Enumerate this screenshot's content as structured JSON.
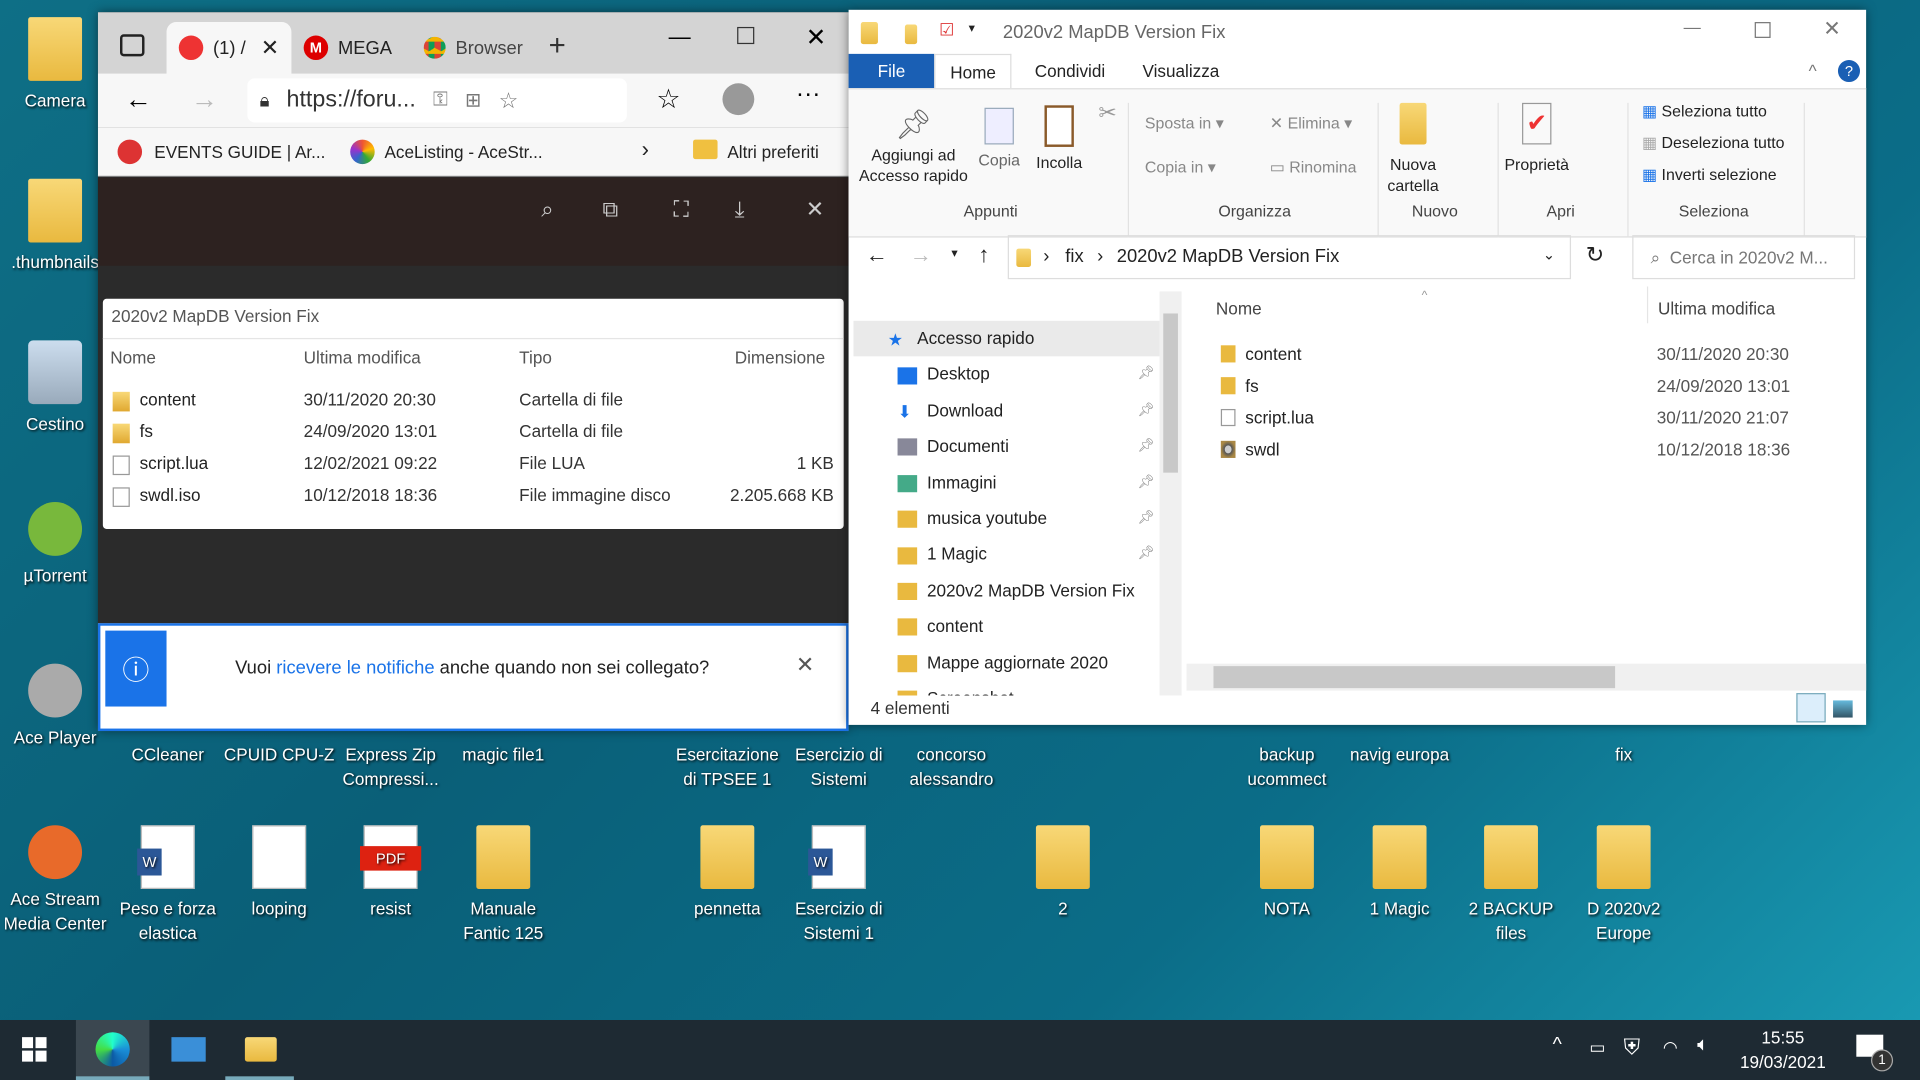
{
  "desktop": {
    "icons": [
      {
        "label": "Camera",
        "type": "folder"
      },
      {
        "label": ".thumbnails",
        "type": "folder"
      },
      {
        "label": "Cestino",
        "type": "bin"
      },
      {
        "label": "µTorrent",
        "type": "app",
        "color": "#78b83c"
      },
      {
        "label": "Ace Player",
        "type": "app",
        "color": "#aaa"
      },
      {
        "label": "CCleaner",
        "type": "none"
      },
      {
        "label": "CPUID CPU-Z",
        "type": "none"
      },
      {
        "label": "Express Zip Compressi...",
        "type": "none"
      },
      {
        "label": "magic file1",
        "type": "none"
      },
      {
        "label": "Esercitazione di TPSEE 1",
        "type": "none"
      },
      {
        "label": "Esercizio di Sistemi",
        "type": "none"
      },
      {
        "label": "concorso alessandro",
        "type": "none"
      },
      {
        "label": "backup ucommect",
        "type": "none"
      },
      {
        "label": "navig europa",
        "type": "none"
      },
      {
        "label": "fix",
        "type": "none"
      },
      {
        "label": "Ace Stream Media Center",
        "type": "app",
        "color": "#e86a2a"
      },
      {
        "label": "Peso e forza elastica",
        "type": "word"
      },
      {
        "label": "looping",
        "type": "image"
      },
      {
        "label": "resist",
        "type": "pdf"
      },
      {
        "label": "Manuale Fantic 125",
        "type": "folder"
      },
      {
        "label": "pennetta",
        "type": "folder"
      },
      {
        "label": "Esercizio di Sistemi 1",
        "type": "word"
      },
      {
        "label": "2",
        "type": "folder"
      },
      {
        "label": "NOTA",
        "type": "folder"
      },
      {
        "label": "1 Magic",
        "type": "folder"
      },
      {
        "label": "2 BACKUP files",
        "type": "folder"
      },
      {
        "label": "D 2020v2 Europe",
        "type": "folder"
      }
    ]
  },
  "browser": {
    "tabs": [
      {
        "label": "(1) /",
        "active": true
      },
      {
        "label": "MEGA"
      },
      {
        "label": "Browser"
      }
    ],
    "url": "https://foru...",
    "favorites": [
      "EVENTS GUIDE | Ar...",
      "AceListing - AceStr..."
    ],
    "other_favorites": "Altri preferiti",
    "archive": {
      "title": "2020v2 MapDB Version Fix",
      "columns": [
        "Nome",
        "Ultima modifica",
        "Tipo",
        "Dimensione"
      ],
      "rows": [
        [
          "content",
          "30/11/2020 20:30",
          "Cartella di file",
          ""
        ],
        [
          "fs",
          "24/09/2020 13:01",
          "Cartella di file",
          ""
        ],
        [
          "script.lua",
          "12/02/2021 09:22",
          "File LUA",
          "1 KB"
        ],
        [
          "swdl.iso",
          "10/12/2018 18:36",
          "File immagine disco",
          "2.205.668 KB"
        ]
      ]
    },
    "notification": {
      "before": "Vuoi ",
      "link": "ricevere le notifiche",
      "after": " anche quando non sei collegato?"
    }
  },
  "explorer": {
    "title": "2020v2 MapDB Version Fix",
    "ribbon_tabs": [
      "File",
      "Home",
      "Condividi",
      "Visualizza"
    ],
    "ribbon": {
      "pin": "Aggiungi ad Accesso rapido",
      "copy": "Copia",
      "paste": "Incolla",
      "move": "Sposta in",
      "copyto": "Copia in",
      "delete": "Elimina",
      "rename": "Rinomina",
      "newfolder": "Nuova cartella",
      "props": "Proprietà",
      "selall": "Seleziona tutto",
      "selnone": "Deseleziona tutto",
      "invert": "Inverti selezione",
      "groups": [
        "Appunti",
        "Organizza",
        "Nuovo",
        "Apri",
        "Seleziona"
      ]
    },
    "breadcrumb": [
      "fix",
      "2020v2 MapDB Version Fix"
    ],
    "search_placeholder": "Cerca in 2020v2 M...",
    "nav": [
      {
        "label": "Accesso rapido",
        "icon": "star"
      },
      {
        "label": "Desktop",
        "icon": "desktop",
        "pin": true
      },
      {
        "label": "Download",
        "icon": "download",
        "pin": true
      },
      {
        "label": "Documenti",
        "icon": "docs",
        "pin": true
      },
      {
        "label": "Immagini",
        "icon": "pictures",
        "pin": true
      },
      {
        "label": "musica youtube",
        "icon": "folder",
        "pin": true
      },
      {
        "label": "1 Magic",
        "icon": "folder",
        "pin": true
      },
      {
        "label": "2020v2 MapDB Version Fix",
        "icon": "folder"
      },
      {
        "label": "content",
        "icon": "folder"
      },
      {
        "label": "Mappe aggiornate 2020",
        "icon": "folder"
      },
      {
        "label": "Screenshot",
        "icon": "folder"
      }
    ],
    "columns": [
      "Nome",
      "Ultima modifica"
    ],
    "files": [
      {
        "name": "content",
        "date": "30/11/2020 20:30",
        "icon": "folder"
      },
      {
        "name": "fs",
        "date": "24/09/2020 13:01",
        "icon": "folder"
      },
      {
        "name": "script.lua",
        "date": "30/11/2020 21:07",
        "icon": "file"
      },
      {
        "name": "swdl",
        "date": "10/12/2018 18:36",
        "icon": "disc"
      }
    ],
    "status": "4 elementi"
  },
  "taskbar": {
    "time": "15:55",
    "date": "19/03/2021",
    "notifications": "1"
  }
}
